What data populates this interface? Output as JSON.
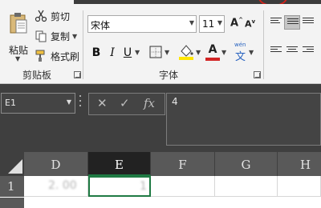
{
  "clipboard": {
    "paste_label": "粘贴",
    "cut_label": "剪切",
    "copy_label": "复制",
    "format_painter_label": "格式刷",
    "group_label": "剪贴板"
  },
  "font": {
    "font_name": "宋体",
    "font_size": "11",
    "bold_label": "B",
    "italic_label": "I",
    "underline_label": "U",
    "phonetic_top": "wén",
    "phonetic_char": "文",
    "group_label": "字体",
    "grow_label": "A",
    "shrink_label": "A",
    "font_color_label": "A",
    "highlight_color": "#ffe600",
    "font_color": "#d22525"
  },
  "formula_bar": {
    "name_box": "E1",
    "cancel_symbol": "✕",
    "enter_symbol": "✓",
    "fx_label": "fx",
    "value": "4"
  },
  "grid": {
    "columns": [
      {
        "label": "D",
        "selected": false
      },
      {
        "label": "E",
        "selected": true
      },
      {
        "label": "F",
        "selected": false
      },
      {
        "label": "G",
        "selected": false
      },
      {
        "label": "H",
        "selected": false
      }
    ],
    "rows": [
      "1"
    ],
    "cell_d1_blurred": "2. 00",
    "cell_e1_blurred": "1"
  },
  "colors": {
    "accent_green": "#1f7a43",
    "annotation_red": "#d0221b",
    "dark_bg": "#3f3f3f"
  }
}
